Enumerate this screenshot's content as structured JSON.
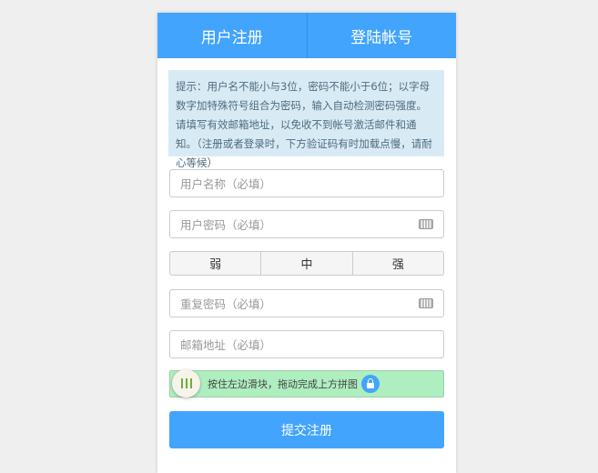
{
  "tabs": {
    "register": "用户注册",
    "login": "登陆帐号"
  },
  "hint": "提示：用户名不能小与3位，密码不能小于6位；以字母数字加特殊符号组合为密码，输入自动检测密码强度。请填写有效邮箱地址，以免收不到帐号激活邮件和通知。（注册或者登录时，下方验证码有时加载点慢，请耐心等候）",
  "fields": {
    "username": "用户名称（必填）",
    "password": "用户密码（必填）",
    "repeat": "重复密码（必填）",
    "email": "邮箱地址（必填）"
  },
  "strength": [
    "弱",
    "中",
    "强"
  ],
  "slider": "按住左边滑块，拖动完成上方拼图",
  "submit": "提交注册"
}
